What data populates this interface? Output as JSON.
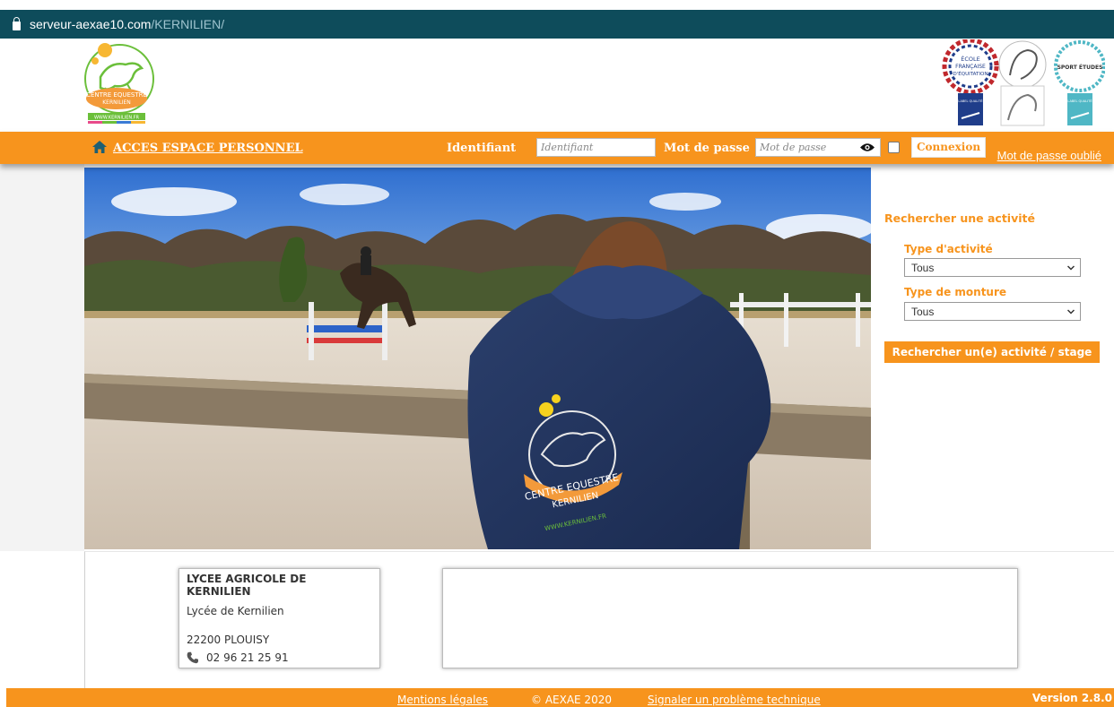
{
  "browser": {
    "url_host": "serveur-aexae10.com",
    "url_path": "/KERNILIEN/"
  },
  "header": {
    "logo_text": [
      "CENTRE EQUESTRE",
      "KERNILIEN",
      "WWW.KERNILIEN.FR"
    ],
    "labels": [
      "ÉCOLE",
      "FRANÇAISE",
      "D'ÉQUITATION",
      "SPORT ÉTUDES",
      "LABEL QUALITÉ"
    ]
  },
  "loginbar": {
    "acces_label": "ACCES ESPACE PERSONNEL",
    "identifiant_label": "Identifiant",
    "identifiant_placeholder": "Identifiant",
    "password_label": "Mot de passe",
    "password_placeholder": "Mot de passe",
    "connexion_label": "Connexion",
    "forgot_label": "Mot de passe oublié"
  },
  "search": {
    "title": "Rechercher une activité",
    "activity_type_label": "Type d'activité",
    "activity_type_value": "Tous",
    "mount_type_label": "Type de monture",
    "mount_type_value": "Tous",
    "button_label": "Rechercher un(e) activité / stage"
  },
  "contact": {
    "name": "LYCEE AGRICOLE DE KERNILIEN",
    "subtitle": "Lycée de Kernilien",
    "city": "22200 PLOUISY",
    "phone": "02 96 21 25 91"
  },
  "footer": {
    "legal": "Mentions légales",
    "copyright": "© AEXAE 2020",
    "report": "Signaler un problème technique",
    "version": "Version 2.8.0"
  },
  "colors": {
    "accent": "#f7941d",
    "urlbar": "#0e4c5b"
  }
}
